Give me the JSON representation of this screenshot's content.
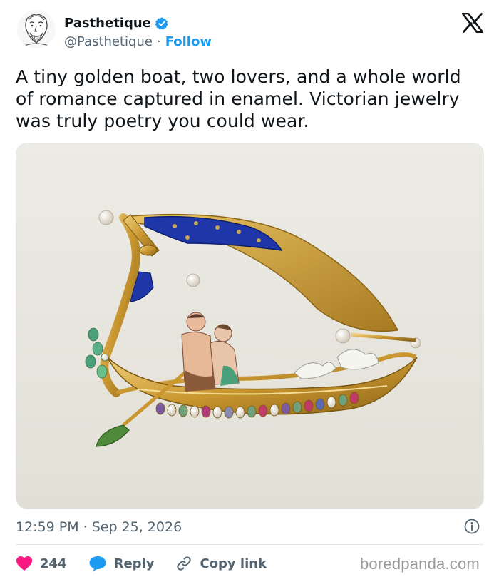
{
  "author": {
    "display_name": "Pasthetique",
    "handle": "@Pasthetique",
    "separator": "·",
    "follow_label": "Follow"
  },
  "tweet": {
    "text_lines": [
      "A tiny golden boat, two lovers, and a whole world",
      "of romance captured in enamel. Victorian jewelry",
      "was truly poetry you could wear."
    ]
  },
  "meta": {
    "time": "12:59 PM",
    "separator": "·",
    "date": "Sep 25, 2026"
  },
  "actions": {
    "likes": "244",
    "reply_label": "Reply",
    "copy_link_label": "Copy link"
  },
  "watermark": "boredpanda.com",
  "colors": {
    "brand_blue": "#1d9bf0",
    "like_red": "#f91880",
    "text": "#0f1419",
    "secondary": "#536471"
  },
  "icons": {
    "verified": "verified-badge-icon",
    "platform": "x-logo-icon",
    "info": "info-icon",
    "like": "heart-icon",
    "reply": "reply-bubble-icon",
    "link": "link-icon"
  }
}
